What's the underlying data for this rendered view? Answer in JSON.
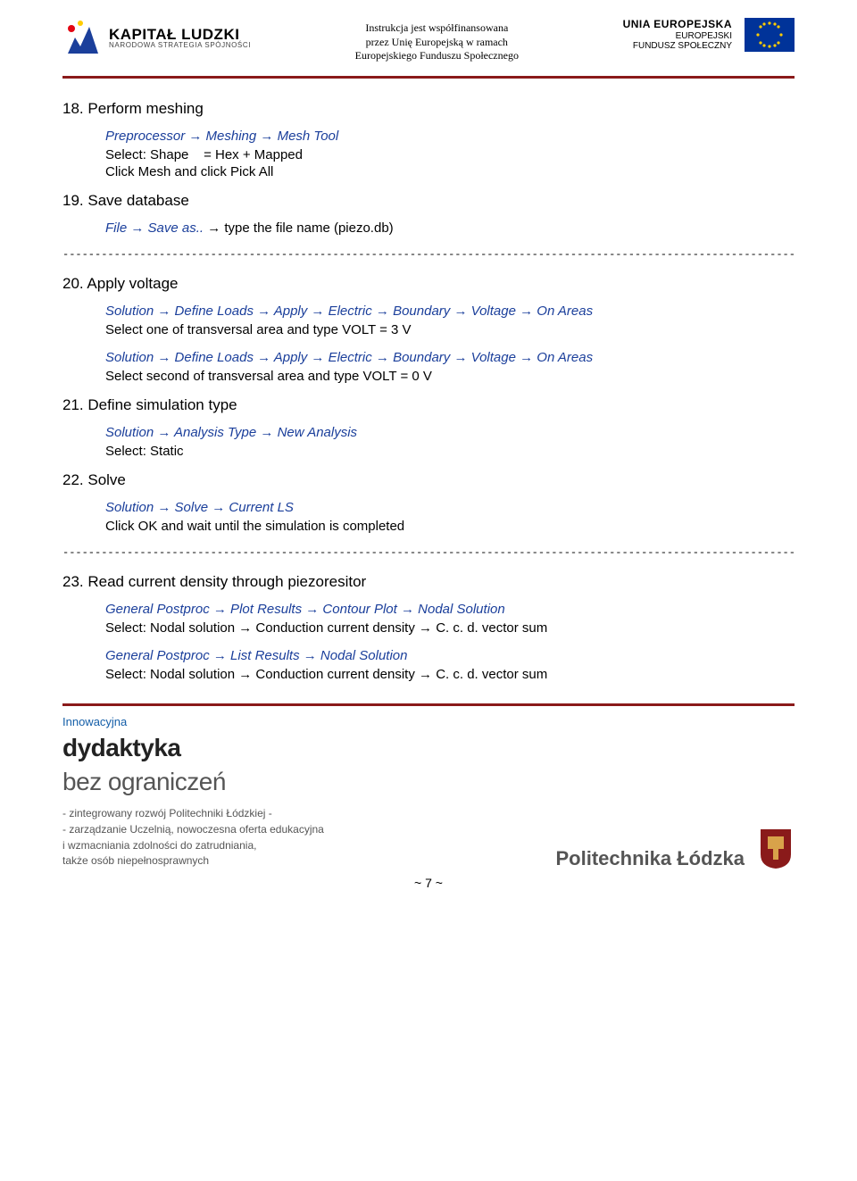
{
  "header": {
    "left_logo_title": "KAPITAŁ LUDZKI",
    "left_logo_sub": "NARODOWA STRATEGIA SPÓJNOŚCI",
    "center_line1": "Instrukcja jest współfinansowana",
    "center_line2": "przez Unię Europejską w ramach",
    "center_line3": "Europejskiego Funduszu Społecznego",
    "right_title": "UNIA EUROPEJSKA",
    "right_sub1": "EUROPEJSKI",
    "right_sub2": "FUNDUSZ SPOŁECZNY"
  },
  "sep": "--------------------------------------------------------------------------------------------------------------------------",
  "s18": {
    "title": "18. Perform meshing",
    "nav": "Preprocessor → Meshing → Mesh Tool",
    "l1": "Select: Shape    = Hex + Mapped",
    "l2": "Click Mesh and click Pick All"
  },
  "s19": {
    "title": "19. Save database",
    "nav_prefix": "File → Save as..",
    "nav_suffix": " → type the file name (piezo.db)"
  },
  "s20": {
    "title": "20. Apply voltage",
    "nav1": "Solution → Define Loads → Apply → Electric → Boundary → Voltage → On Areas",
    "l1": "Select one of transversal area and type VOLT = 3 V",
    "nav2": "Solution → Define Loads → Apply → Electric → Boundary → Voltage → On Areas",
    "l2": "Select second of transversal area and type VOLT = 0 V"
  },
  "s21": {
    "title": "21. Define simulation type",
    "nav": "Solution → Analysis Type → New Analysis",
    "l1": "Select: Static"
  },
  "s22": {
    "title": "22. Solve",
    "nav": "Solution → Solve → Current LS",
    "l1": "Click OK and wait until the simulation is completed"
  },
  "s23": {
    "title": "23. Read current density through piezoresitor",
    "nav1": "General Postproc → Plot Results → Contour Plot → Nodal Solution",
    "l1": "Select: Nodal solution → Conduction current density → C. c. d. vector sum",
    "nav2": "General Postproc → List Results → Nodal Solution",
    "l2": "Select: Nodal solution → Conduction current density → C. c. d. vector sum"
  },
  "footer": {
    "innow": "Innowacyjna",
    "t1": "dydaktyka",
    "t2": "bez ograniczeń",
    "d1": "- zintegrowany rozwój Politechniki Łódzkiej -",
    "d2": "- zarządzanie Uczelnią,  nowoczesna oferta edukacyjna",
    "d3": "i wzmacniania zdolności do zatrudniania,",
    "d4": "także osób niepełnosprawnych",
    "pl": "Politechnika Łódzka",
    "page": "~ 7 ~"
  }
}
